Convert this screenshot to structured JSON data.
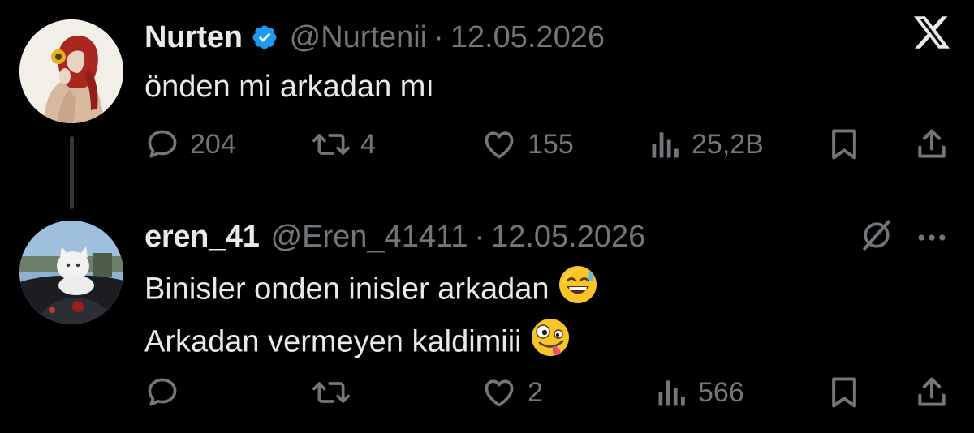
{
  "tweets": [
    {
      "display_name": "Nurten",
      "handle": "@Nurtenii",
      "separator": "·",
      "date": "12.05.2026",
      "verified": true,
      "text_lines": [
        "önden mi arkadan mı"
      ],
      "actions": {
        "reply_count": "204",
        "retweet_count": "4",
        "like_count": "155",
        "views_count": "25,2B"
      }
    },
    {
      "display_name": "eren_41",
      "handle": "@Eren_41411",
      "separator": "·",
      "date": "12.05.2026",
      "verified": false,
      "text_lines": [
        "Binisler onden inisler arkadan",
        "Arkadan vermeyen kaldimiii"
      ],
      "emojis": [
        "grinning-sweat-emoji",
        "zany-face-emoji"
      ],
      "actions": {
        "reply_count": "",
        "retweet_count": "",
        "like_count": "2",
        "views_count": "566"
      }
    }
  ],
  "icons": {
    "brand": "x-logo-icon",
    "verified": "verified-badge-icon",
    "reply": "reply-icon",
    "retweet": "retweet-icon",
    "like": "heart-icon",
    "views": "views-icon",
    "bookmark": "bookmark-icon",
    "share": "share-icon",
    "grok": "grok-icon",
    "more": "more-icon"
  },
  "colors": {
    "background": "#000000",
    "text": "#e7e9ea",
    "muted": "#71767b",
    "verified": "#1d9bf0"
  }
}
